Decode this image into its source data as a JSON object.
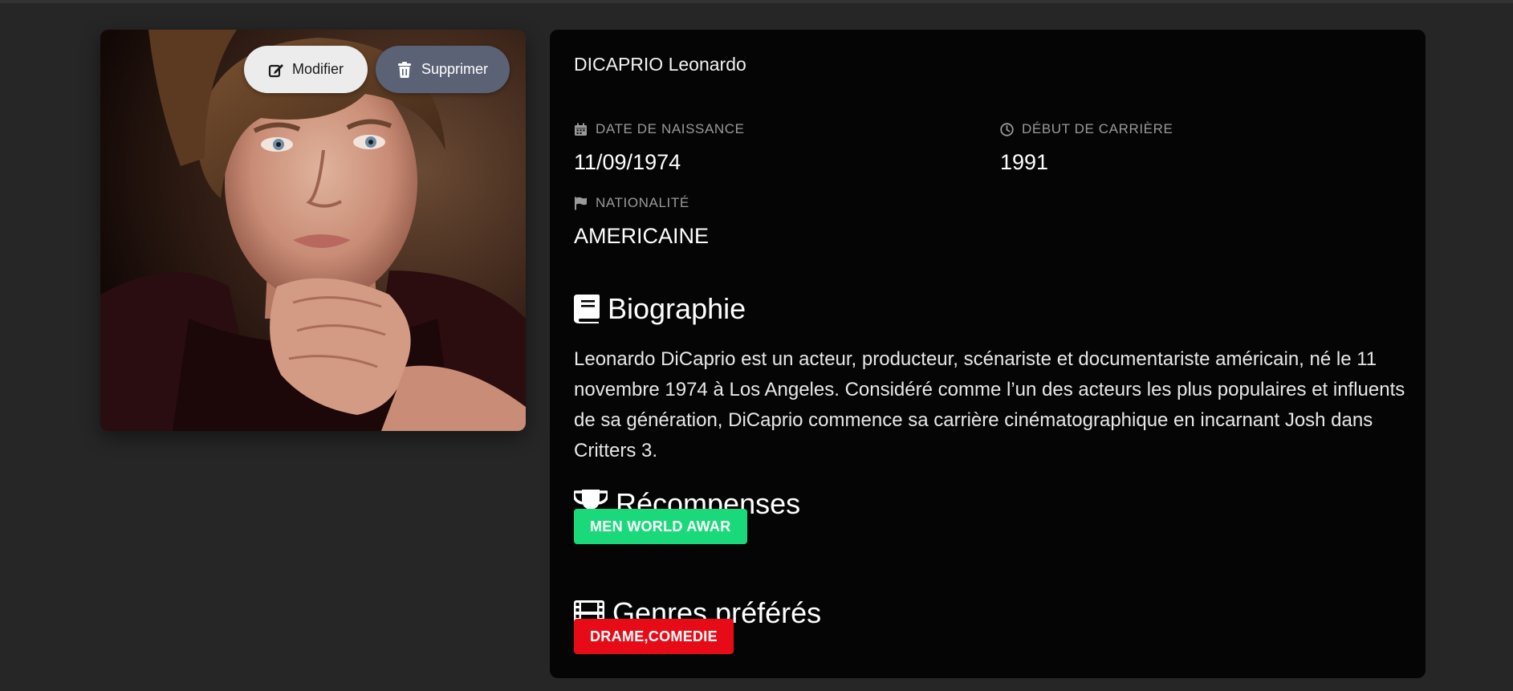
{
  "actions": {
    "edit_label": "Modifier",
    "delete_label": "Supprimer"
  },
  "actor": {
    "full_name": "DICAPRIO Leonardo",
    "birth_date_label": "DATE DE NAISSANCE",
    "birth_date": "11/09/1974",
    "career_start_label": "DÉBUT DE CARRIÈRE",
    "career_start": "1991",
    "nationality_label": "NATIONALITÉ",
    "nationality": "AMERICAINE"
  },
  "biography": {
    "title": "Biographie",
    "text": "Leonardo DiCaprio est un acteur, producteur, scénariste et documentariste américain, né le 11 novembre 1974 à Los Angeles. Considéré comme l’un des acteurs les plus populaires et influents de sa génération, DiCaprio commence sa carrière cinématographique en incarnant Josh dans Critters 3."
  },
  "awards": {
    "title": "Récompenses",
    "items": [
      "MEN WORLD AWAR"
    ]
  },
  "genres": {
    "title": "Genres préférés",
    "items": [
      "DRAME,COMEDIE"
    ]
  },
  "colors": {
    "page_background": "#262626",
    "panel_background": "#050505",
    "award_tag": "#1ad97a",
    "genre_tag": "#e60b17",
    "delete_button": "#5b6275",
    "edit_button": "#ececec"
  },
  "icons": {
    "edit": "edit-icon",
    "delete": "trash-icon",
    "birth_date": "calendar-icon",
    "career_start": "clock-icon",
    "nationality": "flag-icon",
    "biography": "book-icon",
    "awards": "trophy-icon",
    "genres": "film-icon"
  }
}
